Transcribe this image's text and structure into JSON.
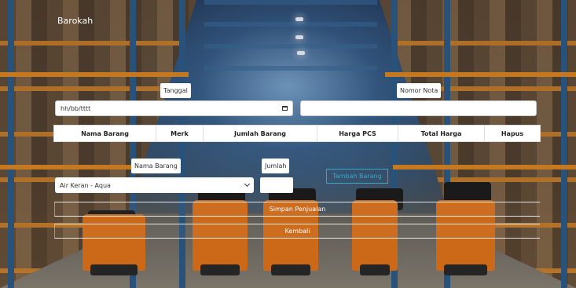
{
  "app": {
    "brand": "Barokah"
  },
  "form": {
    "date": {
      "label": "Tanggal",
      "placeholder": "hh/bb/tttt"
    },
    "note": {
      "label": "Nomor Nota",
      "value": ""
    },
    "item": {
      "label": "Nama Barang",
      "selected": "Air Keran - Aqua"
    },
    "qty": {
      "label": "Jumlah",
      "value": ""
    }
  },
  "table": {
    "columns": [
      "Nama Barang",
      "Merk",
      "Jumlah Barang",
      "Harga PCS",
      "Total Harga",
      "Hapus"
    ]
  },
  "actions": {
    "add_item": "Tambah Barang",
    "save_sale": "Simpan Penjualan",
    "back": "Kembali"
  },
  "icons": {
    "calendar": "calendar-icon",
    "dropdown": "chevron-down-icon"
  },
  "colors": {
    "accent": "#36a7c9",
    "text_on_bg": "#ffffff"
  }
}
